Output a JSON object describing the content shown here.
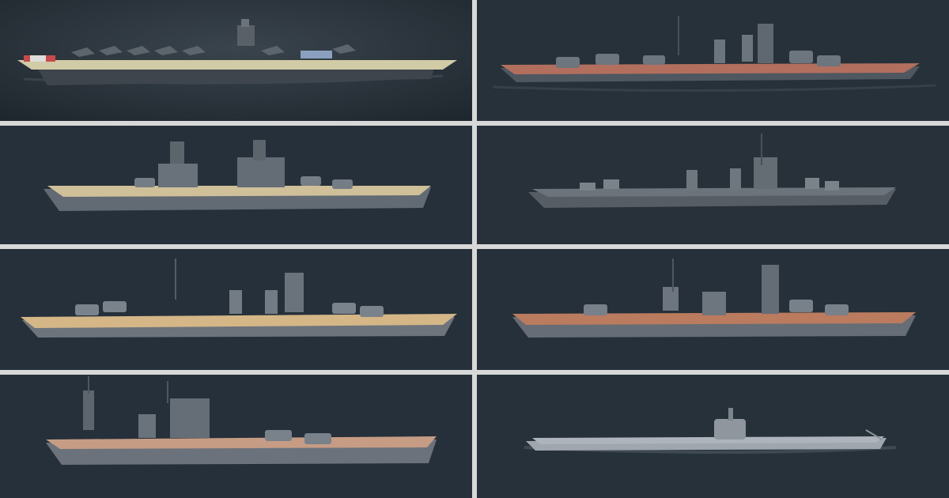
{
  "gallery": {
    "tiles": [
      {
        "subject": "aircraft-carrier",
        "hull": "#4a5058",
        "deck": "#cfc9a6",
        "accent": "#7a8a9c"
      },
      {
        "subject": "battleship",
        "hull": "#59606a",
        "deck": "#b0705e",
        "accent": "#6b737e"
      },
      {
        "subject": "battleship",
        "hull": "#6a7078",
        "deck": "#cdbd8e",
        "accent": "#707882"
      },
      {
        "subject": "light-cruiser",
        "hull": "#5a6168",
        "deck": "#6a7178",
        "accent": "#6c747c"
      },
      {
        "subject": "battlecruiser",
        "hull": "#6e757d",
        "deck": "#d2b587",
        "accent": "#7a828b"
      },
      {
        "subject": "battleship",
        "hull": "#646b74",
        "deck": "#b97a5e",
        "accent": "#6f7782"
      },
      {
        "subject": "battleship",
        "hull": "#6a717b",
        "deck": "#c39a83",
        "accent": "#727a84"
      },
      {
        "subject": "submarine",
        "hull": "#9aa1a8",
        "deck": "#a7aeb5",
        "accent": "#8e959c"
      }
    ],
    "sea_color": "#263038",
    "divider_color": "#d8d8d8"
  }
}
